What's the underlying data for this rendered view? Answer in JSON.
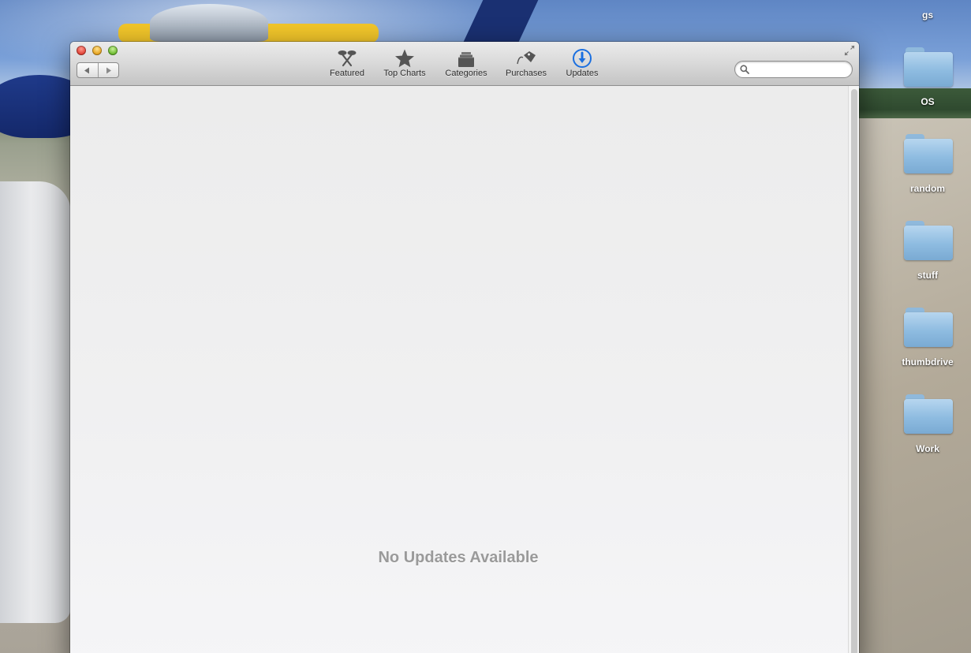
{
  "desktop": {
    "menu_label": "gs",
    "items": [
      {
        "label": "OS",
        "icon": "folder-icon"
      },
      {
        "label": "random",
        "icon": "folder-icon"
      },
      {
        "label": "stuff",
        "icon": "folder-icon"
      },
      {
        "label": "thumbdrive",
        "icon": "folder-icon"
      },
      {
        "label": "Work",
        "icon": "folder-icon"
      }
    ]
  },
  "window": {
    "toolbar": {
      "items": [
        {
          "label": "Featured",
          "icon": "featured-icon"
        },
        {
          "label": "Top Charts",
          "icon": "star-icon"
        },
        {
          "label": "Categories",
          "icon": "categories-icon"
        },
        {
          "label": "Purchases",
          "icon": "price-tag-icon"
        },
        {
          "label": "Updates",
          "icon": "download-arrow-icon",
          "active": true
        }
      ]
    },
    "search": {
      "value": "",
      "placeholder": ""
    },
    "content": {
      "message": "No Updates Available"
    }
  },
  "colors": {
    "active_tab": "#1a6fe0",
    "inactive_icon": "#5a5a5a",
    "message_text": "#9a9a9a",
    "folder_blue": "#8dbbe0"
  }
}
